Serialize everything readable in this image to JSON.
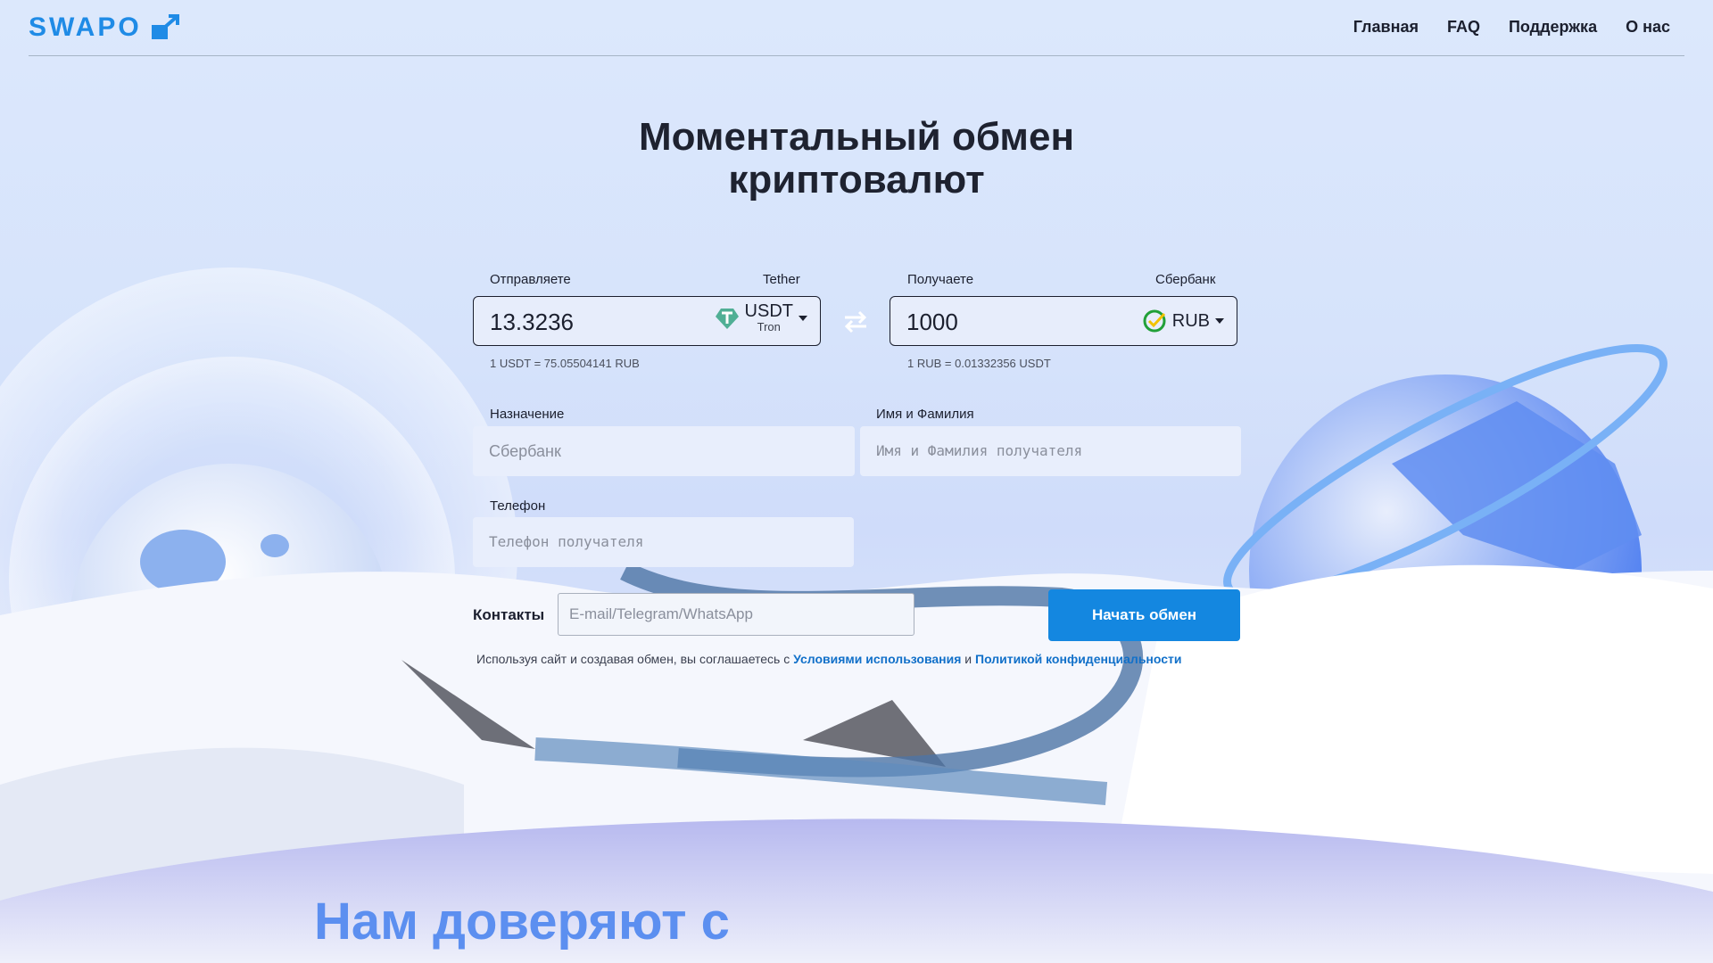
{
  "brand": {
    "name": "SWAPO",
    "accent": "#1f8be6"
  },
  "nav": {
    "items": [
      "Главная",
      "FAQ",
      "Поддержка",
      "О нас"
    ]
  },
  "hero": {
    "title_line1": "Моментальный обмен",
    "title_line2": "криптовалют"
  },
  "send": {
    "label": "Отправляете",
    "provider": "Tether",
    "amount": "13.3236",
    "currency": "USDT",
    "network": "Tron",
    "rate": "1 USDT = 75.05504141 RUB",
    "icon": "tether-icon"
  },
  "swap": {
    "icon": "swap-arrows-icon"
  },
  "receive": {
    "label": "Получаете",
    "provider": "Сбербанк",
    "amount": "1000",
    "currency": "RUB",
    "rate": "1 RUB = 0.01332356 USDT",
    "icon": "sberbank-icon"
  },
  "form": {
    "purpose_label": "Назначение",
    "purpose_placeholder": "Сбербанк",
    "name_label": "Имя и Фамилия",
    "name_placeholder": "Имя и Фамилия получателя",
    "phone_label": "Телефон",
    "phone_placeholder": "Телефон получателя",
    "contacts_label": "Контакты",
    "contacts_placeholder": "E-mail/Telegram/WhatsApp",
    "submit_label": "Начать обмен"
  },
  "legal": {
    "prefix": "Используя сайт и создавая обмен, вы соглашаетесь с",
    "terms_link": "Условиями использования",
    "and": "и",
    "privacy_link": "Политикой конфиденциальности"
  },
  "trust": {
    "heading": "Нам доверяют с"
  },
  "colors": {
    "button": "#1487e0",
    "link": "#1170c9",
    "heading_blue": "#5c8ff0"
  }
}
